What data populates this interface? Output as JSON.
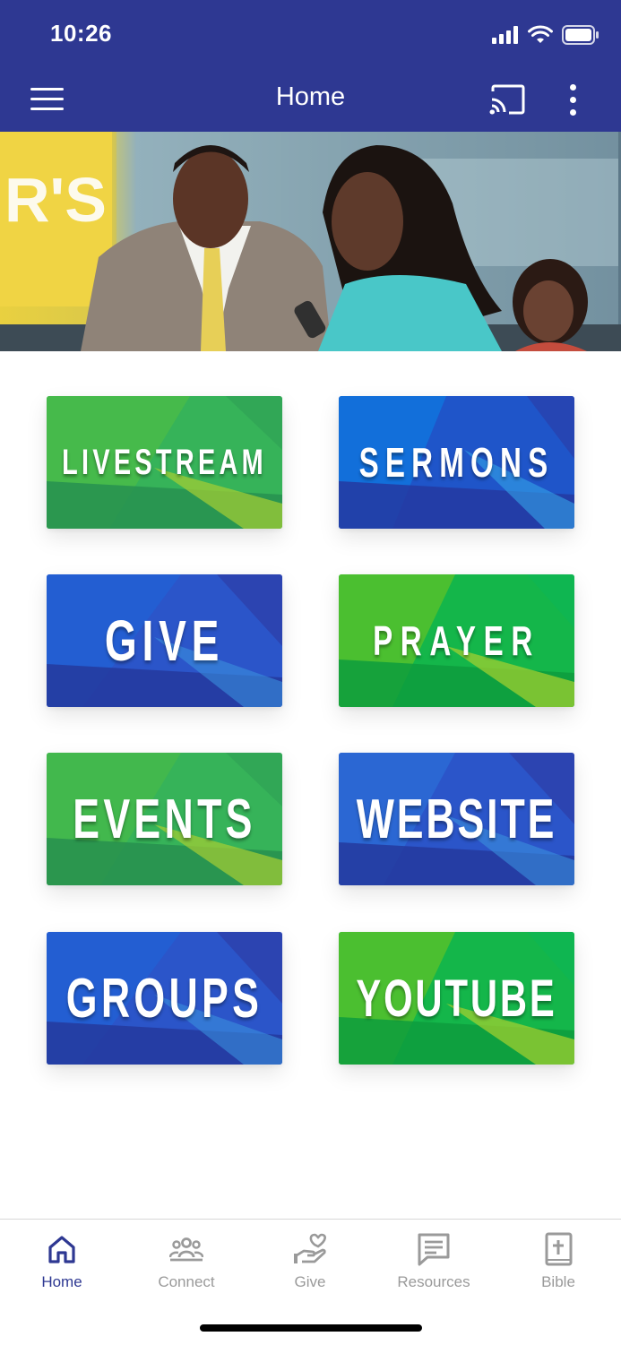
{
  "status_bar": {
    "time": "10:26"
  },
  "app_bar": {
    "title": "Home"
  },
  "tiles": [
    {
      "label": "LIVESTREAM",
      "theme": "green"
    },
    {
      "label": "SERMONS",
      "theme": "blue"
    },
    {
      "label": "GIVE",
      "theme": "blue"
    },
    {
      "label": "PRAYER",
      "theme": "green"
    },
    {
      "label": "EVENTS",
      "theme": "green"
    },
    {
      "label": "WEBSITE",
      "theme": "blue"
    },
    {
      "label": "GROUPS",
      "theme": "blue"
    },
    {
      "label": "YOUTUBE",
      "theme": "green"
    }
  ],
  "bottom_nav": {
    "items": [
      {
        "label": "Home",
        "icon": "home-icon"
      },
      {
        "label": "Connect",
        "icon": "people-icon"
      },
      {
        "label": "Give",
        "icon": "heart-hand-icon"
      },
      {
        "label": "Resources",
        "icon": "message-icon"
      },
      {
        "label": "Bible",
        "icon": "bible-icon"
      }
    ]
  },
  "colors": {
    "primary": "#2e3892",
    "nav_inactive": "#9a9a9a",
    "tile_green": "#3cb35a",
    "tile_blue": "#1f55c9"
  }
}
